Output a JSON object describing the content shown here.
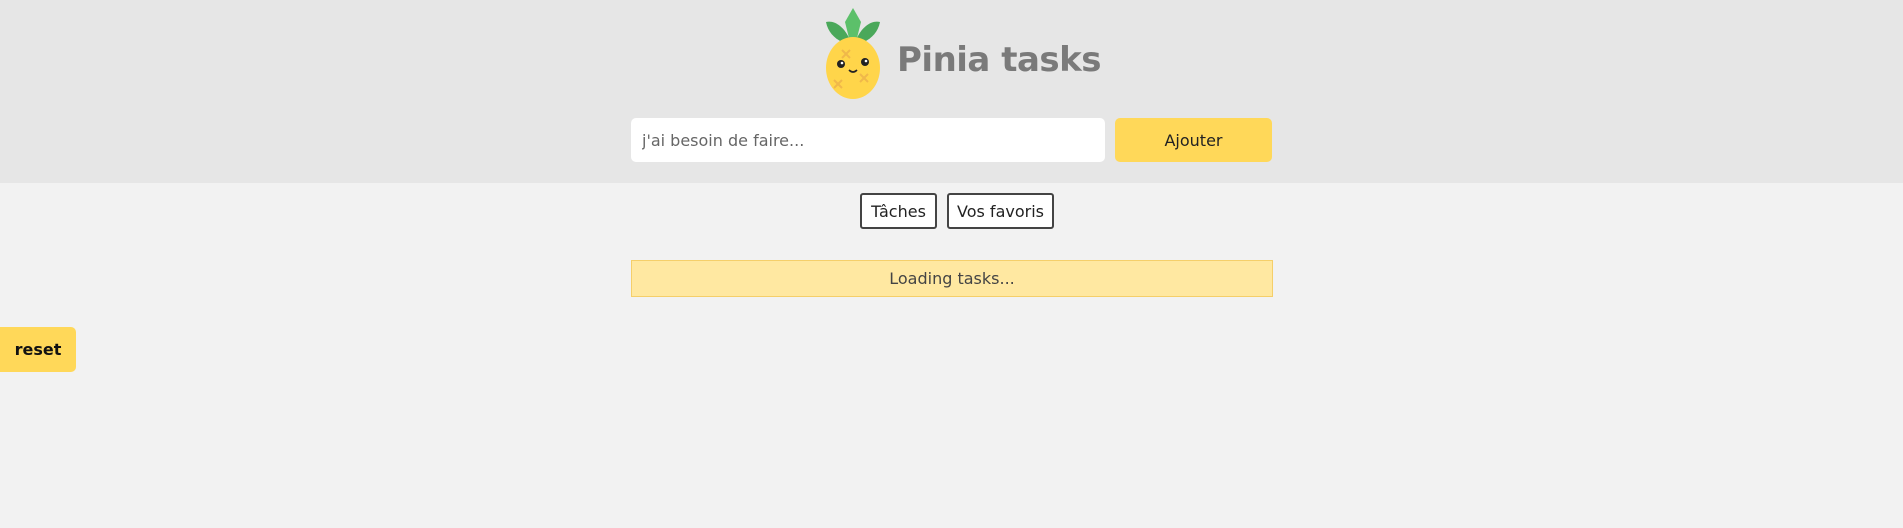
{
  "header": {
    "logo_icon": "pineapple-icon",
    "title": "Pinia tasks"
  },
  "form": {
    "input_value": "",
    "input_placeholder": "j'ai besoin de faire...",
    "add_label": "Ajouter"
  },
  "filters": {
    "tasks_label": "Tâches",
    "favorites_label": "Vos favoris"
  },
  "status": {
    "loading_text": "Loading tasks..."
  },
  "reset": {
    "label": "reset"
  },
  "colors": {
    "accent": "#ffd859",
    "header_bg": "#e6e6e6",
    "page_bg": "#f2f2f2",
    "loading_bg": "#ffe8a1",
    "title": "#7a7a7a"
  }
}
